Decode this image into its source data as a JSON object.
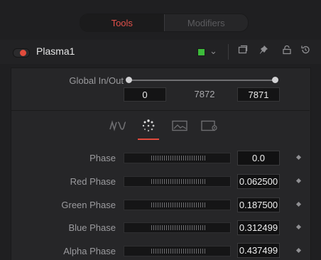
{
  "tabs": {
    "tools": "Tools",
    "modifiers": "Modifiers"
  },
  "tool": {
    "name": "Plasma1",
    "color_swatch": "#3dbb3b"
  },
  "header_icons": [
    "chevron-down-icon",
    "windows-icon",
    "pin-icon",
    "lock-icon",
    "reset-icon"
  ],
  "global_in_out": {
    "label": "Global In/Out",
    "in": "0",
    "mid": "7872",
    "out": "7871"
  },
  "inspector_tabs": [
    "controls-icon",
    "circles-icon",
    "image-icon",
    "settings-icon"
  ],
  "rows": [
    {
      "label": "Phase",
      "value": "0.0"
    },
    {
      "label": "Red Phase",
      "value": "0.062500"
    },
    {
      "label": "Green Phase",
      "value": "0.187500"
    },
    {
      "label": "Blue Phase",
      "value": "0.312499"
    },
    {
      "label": "Alpha Phase",
      "value": "0.437499"
    }
  ],
  "colors": {
    "accent": "#e2504a",
    "background": "#1f1f21",
    "panel": "#262628"
  }
}
